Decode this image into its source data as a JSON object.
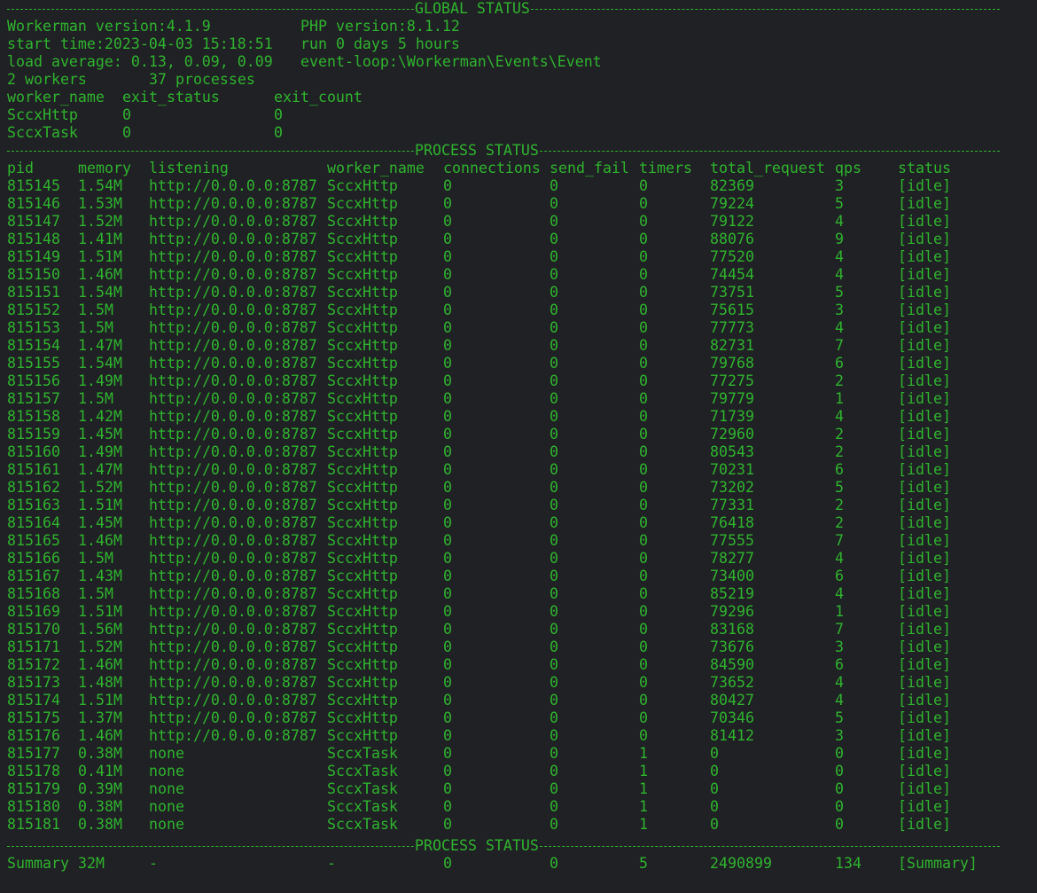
{
  "global": {
    "title": "GLOBAL STATUS",
    "workerman_version": "Workerman version:4.1.9",
    "php_version": "PHP version:8.1.12",
    "start_time": "start time:2023-04-03 15:18:51",
    "run_time": "run 0 days 5 hours",
    "load_average": "load average: 0.13, 0.09, 0.09",
    "event_loop": "event-loop:\\Workerman\\Events\\Event",
    "workers": "2 workers",
    "processes": "37 processes",
    "worker_headers": [
      "worker_name",
      "exit_status",
      "exit_count"
    ],
    "workers_list": [
      {
        "worker_name": "SccxHttp",
        "exit_status": "0",
        "exit_count": "0"
      },
      {
        "worker_name": "SccxTask",
        "exit_status": "0",
        "exit_count": "0"
      }
    ]
  },
  "process_status_title": "PROCESS STATUS",
  "process_headers": [
    "pid",
    "memory",
    "listening",
    "worker_name",
    "connections",
    "send_fail",
    "timers",
    "total_request",
    "qps",
    "status"
  ],
  "processes": [
    [
      "815145",
      "1.54M",
      "http://0.0.0.0:8787",
      "SccxHttp",
      "0",
      "0",
      "0",
      "82369",
      "3",
      "[idle]"
    ],
    [
      "815146",
      "1.53M",
      "http://0.0.0.0:8787",
      "SccxHttp",
      "0",
      "0",
      "0",
      "79224",
      "5",
      "[idle]"
    ],
    [
      "815147",
      "1.52M",
      "http://0.0.0.0:8787",
      "SccxHttp",
      "0",
      "0",
      "0",
      "79122",
      "4",
      "[idle]"
    ],
    [
      "815148",
      "1.41M",
      "http://0.0.0.0:8787",
      "SccxHttp",
      "0",
      "0",
      "0",
      "88076",
      "9",
      "[idle]"
    ],
    [
      "815149",
      "1.51M",
      "http://0.0.0.0:8787",
      "SccxHttp",
      "0",
      "0",
      "0",
      "77520",
      "4",
      "[idle]"
    ],
    [
      "815150",
      "1.46M",
      "http://0.0.0.0:8787",
      "SccxHttp",
      "0",
      "0",
      "0",
      "74454",
      "4",
      "[idle]"
    ],
    [
      "815151",
      "1.54M",
      "http://0.0.0.0:8787",
      "SccxHttp",
      "0",
      "0",
      "0",
      "73751",
      "5",
      "[idle]"
    ],
    [
      "815152",
      "1.5M",
      "http://0.0.0.0:8787",
      "SccxHttp",
      "0",
      "0",
      "0",
      "75615",
      "3",
      "[idle]"
    ],
    [
      "815153",
      "1.5M",
      "http://0.0.0.0:8787",
      "SccxHttp",
      "0",
      "0",
      "0",
      "77773",
      "4",
      "[idle]"
    ],
    [
      "815154",
      "1.47M",
      "http://0.0.0.0:8787",
      "SccxHttp",
      "0",
      "0",
      "0",
      "82731",
      "7",
      "[idle]"
    ],
    [
      "815155",
      "1.54M",
      "http://0.0.0.0:8787",
      "SccxHttp",
      "0",
      "0",
      "0",
      "79768",
      "6",
      "[idle]"
    ],
    [
      "815156",
      "1.49M",
      "http://0.0.0.0:8787",
      "SccxHttp",
      "0",
      "0",
      "0",
      "77275",
      "2",
      "[idle]"
    ],
    [
      "815157",
      "1.5M",
      "http://0.0.0.0:8787",
      "SccxHttp",
      "0",
      "0",
      "0",
      "79779",
      "1",
      "[idle]"
    ],
    [
      "815158",
      "1.42M",
      "http://0.0.0.0:8787",
      "SccxHttp",
      "0",
      "0",
      "0",
      "71739",
      "4",
      "[idle]"
    ],
    [
      "815159",
      "1.45M",
      "http://0.0.0.0:8787",
      "SccxHttp",
      "0",
      "0",
      "0",
      "72960",
      "2",
      "[idle]"
    ],
    [
      "815160",
      "1.49M",
      "http://0.0.0.0:8787",
      "SccxHttp",
      "0",
      "0",
      "0",
      "80543",
      "2",
      "[idle]"
    ],
    [
      "815161",
      "1.47M",
      "http://0.0.0.0:8787",
      "SccxHttp",
      "0",
      "0",
      "0",
      "70231",
      "6",
      "[idle]"
    ],
    [
      "815162",
      "1.52M",
      "http://0.0.0.0:8787",
      "SccxHttp",
      "0",
      "0",
      "0",
      "73202",
      "5",
      "[idle]"
    ],
    [
      "815163",
      "1.51M",
      "http://0.0.0.0:8787",
      "SccxHttp",
      "0",
      "0",
      "0",
      "77331",
      "2",
      "[idle]"
    ],
    [
      "815164",
      "1.45M",
      "http://0.0.0.0:8787",
      "SccxHttp",
      "0",
      "0",
      "0",
      "76418",
      "2",
      "[idle]"
    ],
    [
      "815165",
      "1.46M",
      "http://0.0.0.0:8787",
      "SccxHttp",
      "0",
      "0",
      "0",
      "77555",
      "7",
      "[idle]"
    ],
    [
      "815166",
      "1.5M",
      "http://0.0.0.0:8787",
      "SccxHttp",
      "0",
      "0",
      "0",
      "78277",
      "4",
      "[idle]"
    ],
    [
      "815167",
      "1.43M",
      "http://0.0.0.0:8787",
      "SccxHttp",
      "0",
      "0",
      "0",
      "73400",
      "6",
      "[idle]"
    ],
    [
      "815168",
      "1.5M",
      "http://0.0.0.0:8787",
      "SccxHttp",
      "0",
      "0",
      "0",
      "85219",
      "4",
      "[idle]"
    ],
    [
      "815169",
      "1.51M",
      "http://0.0.0.0:8787",
      "SccxHttp",
      "0",
      "0",
      "0",
      "79296",
      "1",
      "[idle]"
    ],
    [
      "815170",
      "1.56M",
      "http://0.0.0.0:8787",
      "SccxHttp",
      "0",
      "0",
      "0",
      "83168",
      "7",
      "[idle]"
    ],
    [
      "815171",
      "1.52M",
      "http://0.0.0.0:8787",
      "SccxHttp",
      "0",
      "0",
      "0",
      "73676",
      "3",
      "[idle]"
    ],
    [
      "815172",
      "1.46M",
      "http://0.0.0.0:8787",
      "SccxHttp",
      "0",
      "0",
      "0",
      "84590",
      "6",
      "[idle]"
    ],
    [
      "815173",
      "1.48M",
      "http://0.0.0.0:8787",
      "SccxHttp",
      "0",
      "0",
      "0",
      "73652",
      "4",
      "[idle]"
    ],
    [
      "815174",
      "1.51M",
      "http://0.0.0.0:8787",
      "SccxHttp",
      "0",
      "0",
      "0",
      "80427",
      "4",
      "[idle]"
    ],
    [
      "815175",
      "1.37M",
      "http://0.0.0.0:8787",
      "SccxHttp",
      "0",
      "0",
      "0",
      "70346",
      "5",
      "[idle]"
    ],
    [
      "815176",
      "1.46M",
      "http://0.0.0.0:8787",
      "SccxHttp",
      "0",
      "0",
      "0",
      "81412",
      "3",
      "[idle]"
    ],
    [
      "815177",
      "0.38M",
      "none",
      "SccxTask",
      "0",
      "0",
      "1",
      "0",
      "0",
      "[idle]"
    ],
    [
      "815178",
      "0.41M",
      "none",
      "SccxTask",
      "0",
      "0",
      "1",
      "0",
      "0",
      "[idle]"
    ],
    [
      "815179",
      "0.39M",
      "none",
      "SccxTask",
      "0",
      "0",
      "1",
      "0",
      "0",
      "[idle]"
    ],
    [
      "815180",
      "0.38M",
      "none",
      "SccxTask",
      "0",
      "0",
      "1",
      "0",
      "0",
      "[idle]"
    ],
    [
      "815181",
      "0.38M",
      "none",
      "SccxTask",
      "0",
      "0",
      "1",
      "0",
      "0",
      "[idle]"
    ]
  ],
  "summary": [
    "Summary",
    "32M",
    "-",
    "-",
    "0",
    "0",
    "5",
    "2490899",
    "134",
    "[Summary]"
  ],
  "colors": {
    "background": "#202124",
    "text": "#2fb32f"
  }
}
